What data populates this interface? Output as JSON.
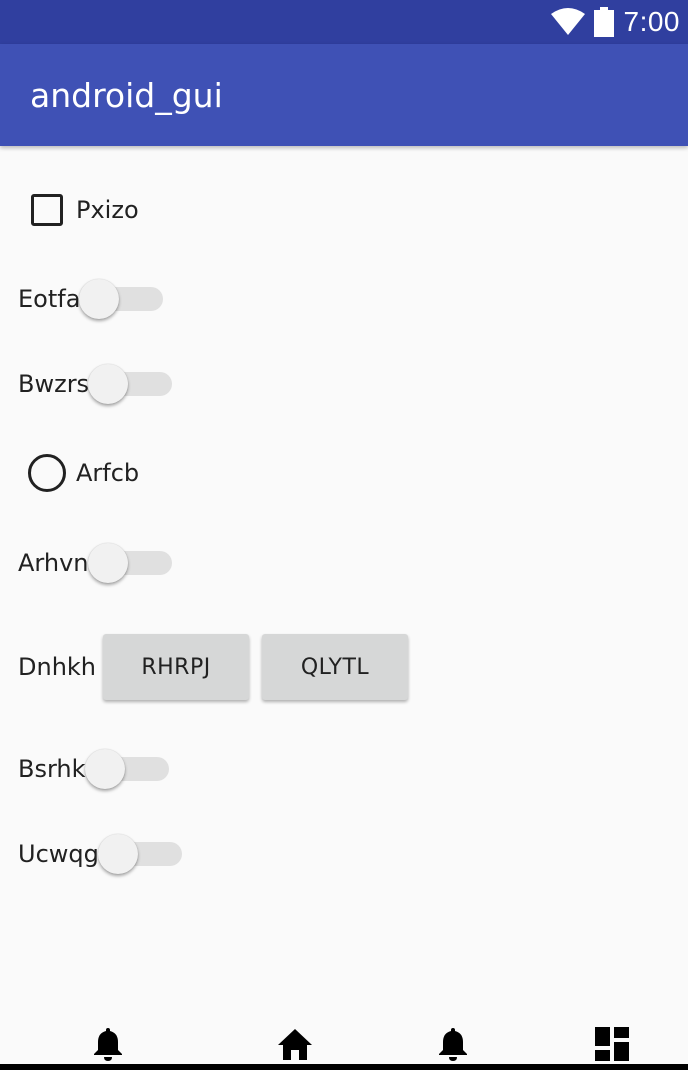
{
  "status_bar": {
    "time": "7:00",
    "icons": [
      "wifi-icon",
      "battery-icon"
    ],
    "color": "#303f9f"
  },
  "app_bar": {
    "title": "android_gui",
    "color": "#3f51b5"
  },
  "widgets": {
    "checkbox": {
      "label": "Pxizo",
      "checked": false
    },
    "switch_1": {
      "label": "Eotfa",
      "on": false
    },
    "switch_2": {
      "label": "Bwzrs",
      "on": false
    },
    "radio": {
      "label": "Arfcb",
      "selected": false
    },
    "switch_3": {
      "label": "Arhvn",
      "on": false
    },
    "button_row": {
      "label": "Dnhkh",
      "button_1": "RHRPJ",
      "button_2": "QLYTL"
    },
    "switch_4": {
      "label": "Bsrhk",
      "on": false
    },
    "switch_5": {
      "label": "Ucwqg",
      "on": false
    }
  },
  "bottom_nav": {
    "items": [
      "bell-icon",
      "home-icon",
      "bell-icon",
      "dashboard-icon"
    ]
  }
}
